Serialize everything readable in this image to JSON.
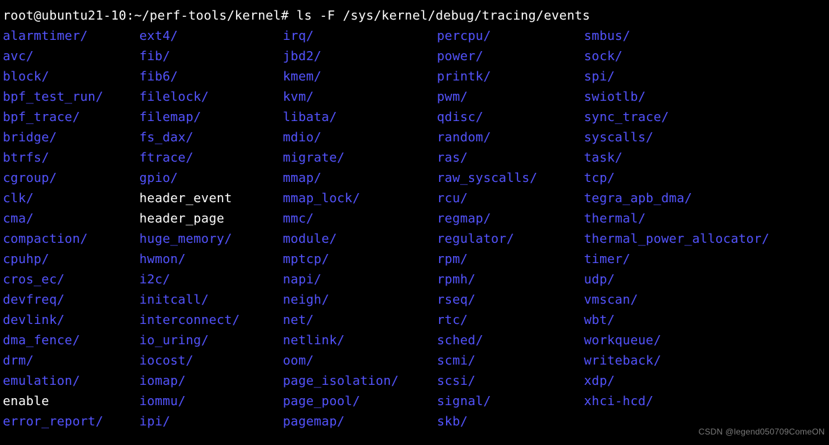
{
  "prompt": "root@ubuntu21-10:~/perf-tools/kernel# ",
  "command": "ls -F /sys/kernel/debug/tracing/events",
  "columns": [
    [
      {
        "name": "alarmtimer",
        "type": "dir"
      },
      {
        "name": "avc",
        "type": "dir"
      },
      {
        "name": "block",
        "type": "dir"
      },
      {
        "name": "bpf_test_run",
        "type": "dir"
      },
      {
        "name": "bpf_trace",
        "type": "dir"
      },
      {
        "name": "bridge",
        "type": "dir"
      },
      {
        "name": "btrfs",
        "type": "dir"
      },
      {
        "name": "cgroup",
        "type": "dir"
      },
      {
        "name": "clk",
        "type": "dir"
      },
      {
        "name": "cma",
        "type": "dir"
      },
      {
        "name": "compaction",
        "type": "dir"
      },
      {
        "name": "cpuhp",
        "type": "dir"
      },
      {
        "name": "cros_ec",
        "type": "dir"
      },
      {
        "name": "devfreq",
        "type": "dir"
      },
      {
        "name": "devlink",
        "type": "dir"
      },
      {
        "name": "dma_fence",
        "type": "dir"
      },
      {
        "name": "drm",
        "type": "dir"
      },
      {
        "name": "emulation",
        "type": "dir"
      },
      {
        "name": "enable",
        "type": "file"
      },
      {
        "name": "error_report",
        "type": "dir"
      }
    ],
    [
      {
        "name": "ext4",
        "type": "dir"
      },
      {
        "name": "fib",
        "type": "dir"
      },
      {
        "name": "fib6",
        "type": "dir"
      },
      {
        "name": "filelock",
        "type": "dir"
      },
      {
        "name": "filemap",
        "type": "dir"
      },
      {
        "name": "fs_dax",
        "type": "dir"
      },
      {
        "name": "ftrace",
        "type": "dir"
      },
      {
        "name": "gpio",
        "type": "dir"
      },
      {
        "name": "header_event",
        "type": "file"
      },
      {
        "name": "header_page",
        "type": "file"
      },
      {
        "name": "huge_memory",
        "type": "dir"
      },
      {
        "name": "hwmon",
        "type": "dir"
      },
      {
        "name": "i2c",
        "type": "dir"
      },
      {
        "name": "initcall",
        "type": "dir"
      },
      {
        "name": "interconnect",
        "type": "dir"
      },
      {
        "name": "io_uring",
        "type": "dir"
      },
      {
        "name": "iocost",
        "type": "dir"
      },
      {
        "name": "iomap",
        "type": "dir"
      },
      {
        "name": "iommu",
        "type": "dir"
      },
      {
        "name": "ipi",
        "type": "dir"
      }
    ],
    [
      {
        "name": "irq",
        "type": "dir"
      },
      {
        "name": "jbd2",
        "type": "dir"
      },
      {
        "name": "kmem",
        "type": "dir"
      },
      {
        "name": "kvm",
        "type": "dir"
      },
      {
        "name": "libata",
        "type": "dir"
      },
      {
        "name": "mdio",
        "type": "dir"
      },
      {
        "name": "migrate",
        "type": "dir"
      },
      {
        "name": "mmap",
        "type": "dir"
      },
      {
        "name": "mmap_lock",
        "type": "dir"
      },
      {
        "name": "mmc",
        "type": "dir"
      },
      {
        "name": "module",
        "type": "dir"
      },
      {
        "name": "mptcp",
        "type": "dir"
      },
      {
        "name": "napi",
        "type": "dir"
      },
      {
        "name": "neigh",
        "type": "dir"
      },
      {
        "name": "net",
        "type": "dir"
      },
      {
        "name": "netlink",
        "type": "dir"
      },
      {
        "name": "oom",
        "type": "dir"
      },
      {
        "name": "page_isolation",
        "type": "dir"
      },
      {
        "name": "page_pool",
        "type": "dir"
      },
      {
        "name": "pagemap",
        "type": "dir"
      }
    ],
    [
      {
        "name": "percpu",
        "type": "dir"
      },
      {
        "name": "power",
        "type": "dir"
      },
      {
        "name": "printk",
        "type": "dir"
      },
      {
        "name": "pwm",
        "type": "dir"
      },
      {
        "name": "qdisc",
        "type": "dir"
      },
      {
        "name": "random",
        "type": "dir"
      },
      {
        "name": "ras",
        "type": "dir"
      },
      {
        "name": "raw_syscalls",
        "type": "dir"
      },
      {
        "name": "rcu",
        "type": "dir"
      },
      {
        "name": "regmap",
        "type": "dir"
      },
      {
        "name": "regulator",
        "type": "dir"
      },
      {
        "name": "rpm",
        "type": "dir"
      },
      {
        "name": "rpmh",
        "type": "dir"
      },
      {
        "name": "rseq",
        "type": "dir"
      },
      {
        "name": "rtc",
        "type": "dir"
      },
      {
        "name": "sched",
        "type": "dir"
      },
      {
        "name": "scmi",
        "type": "dir"
      },
      {
        "name": "scsi",
        "type": "dir"
      },
      {
        "name": "signal",
        "type": "dir"
      },
      {
        "name": "skb",
        "type": "dir"
      }
    ],
    [
      {
        "name": "smbus",
        "type": "dir"
      },
      {
        "name": "sock",
        "type": "dir"
      },
      {
        "name": "spi",
        "type": "dir"
      },
      {
        "name": "swiotlb",
        "type": "dir"
      },
      {
        "name": "sync_trace",
        "type": "dir"
      },
      {
        "name": "syscalls",
        "type": "dir"
      },
      {
        "name": "task",
        "type": "dir"
      },
      {
        "name": "tcp",
        "type": "dir"
      },
      {
        "name": "tegra_apb_dma",
        "type": "dir"
      },
      {
        "name": "thermal",
        "type": "dir"
      },
      {
        "name": "thermal_power_allocator",
        "type": "dir"
      },
      {
        "name": "timer",
        "type": "dir"
      },
      {
        "name": "udp",
        "type": "dir"
      },
      {
        "name": "vmscan",
        "type": "dir"
      },
      {
        "name": "wbt",
        "type": "dir"
      },
      {
        "name": "workqueue",
        "type": "dir"
      },
      {
        "name": "writeback",
        "type": "dir"
      },
      {
        "name": "xdp",
        "type": "dir"
      },
      {
        "name": "xhci-hcd",
        "type": "dir"
      },
      {
        "name": "",
        "type": "blank"
      }
    ]
  ],
  "watermark": "CSDN @legend050709ComeON"
}
